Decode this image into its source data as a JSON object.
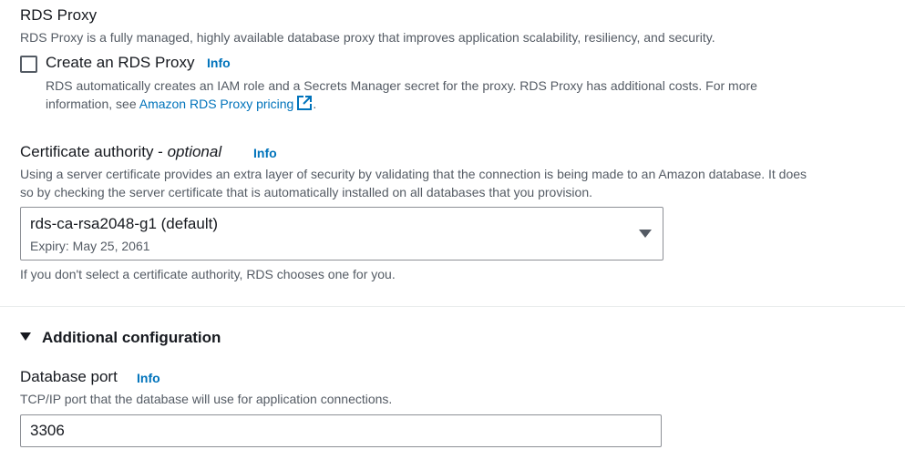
{
  "rds_proxy": {
    "heading": "RDS Proxy",
    "description": "RDS Proxy is a fully managed, highly available database proxy that improves application scalability, resiliency, and security.",
    "checkbox_label": "Create an RDS Proxy",
    "checkbox_checked": false,
    "info_label": "Info",
    "note_line1": "RDS automatically creates an IAM role and a Secrets Manager secret for the proxy. RDS Proxy has additional costs. For more",
    "note_line2_prefix": "information, see ",
    "note_link": "Amazon RDS Proxy pricing",
    "note_line2_suffix": "."
  },
  "certificate_authority": {
    "label": "Certificate authority - ",
    "label_optional": "optional",
    "info_label": "Info",
    "description_line1": "Using a server certificate provides an extra layer of security by validating that the connection is being made to an Amazon database. It does",
    "description_line2": "so by checking the server certificate that is automatically installed on all databases that you provision.",
    "selected_value": "rds-ca-rsa2048-g1 (default)",
    "selected_sub": "Expiry: May 25, 2061",
    "hint": "If you don't select a certificate authority, RDS chooses one for you."
  },
  "additional_configuration": {
    "title": "Additional configuration",
    "expanded": true,
    "database_port": {
      "label": "Database port",
      "info_label": "Info",
      "description": "TCP/IP port that the database will use for application connections.",
      "value": "3306"
    }
  },
  "colors": {
    "link": "#0073bb",
    "text": "#16191f",
    "secondary_text": "#545b64",
    "border": "#8d9096"
  }
}
